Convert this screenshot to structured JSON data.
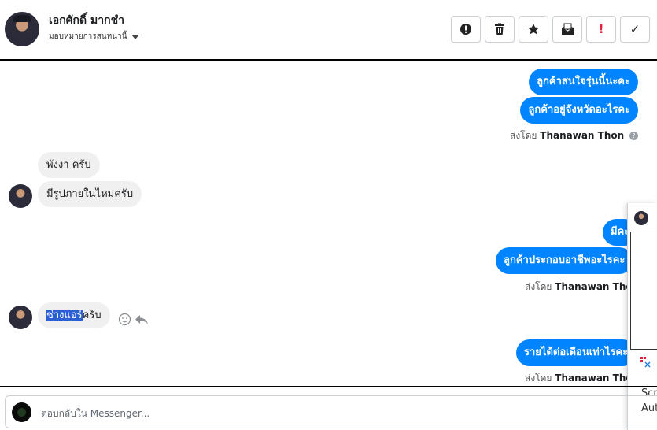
{
  "header": {
    "name": "เอกศักดิ์ มากชำ",
    "assign_label": "มอบหมายการสนทนานี้",
    "buttons": [
      {
        "icon": "exclamation-circle-icon",
        "glyph": "❗"
      },
      {
        "icon": "trash-icon",
        "glyph": "🗑"
      },
      {
        "icon": "star-icon",
        "glyph": "★"
      },
      {
        "icon": "envelope-icon",
        "glyph": "✉"
      },
      {
        "icon": "spam-icon",
        "glyph": "!"
      },
      {
        "icon": "check-icon",
        "glyph": "✓"
      }
    ]
  },
  "messages": {
    "out1": "ลูกค้าสนใจรุ่นนี้นะคะ",
    "out2": "ลูกค้าอยู่จังหวัดอะไรคะ",
    "sent_prefix": "ส่งโดย",
    "sender": "Thanawan Thon",
    "in1": "พังงา ครับ",
    "in2": "มีรูปภายในไหมครับ",
    "out3": "มีคะ",
    "out4": "ลูกค้าประกอบอาชีพอะไรคะ",
    "in3_highlight": "ช่างแอร์",
    "in3_rest": "ครับ",
    "out5": "รายได้ต่อเดือนเท่าไรคะ"
  },
  "overlay": {
    "line1": "Scre",
    "line2": "Auto"
  },
  "composer": {
    "placeholder": "ตอบกลับใน Messenger..."
  },
  "colors": {
    "outgoing_bubble": "#0084ff",
    "incoming_bubble": "#f1f0f0",
    "highlight": "#2c5fd3"
  }
}
